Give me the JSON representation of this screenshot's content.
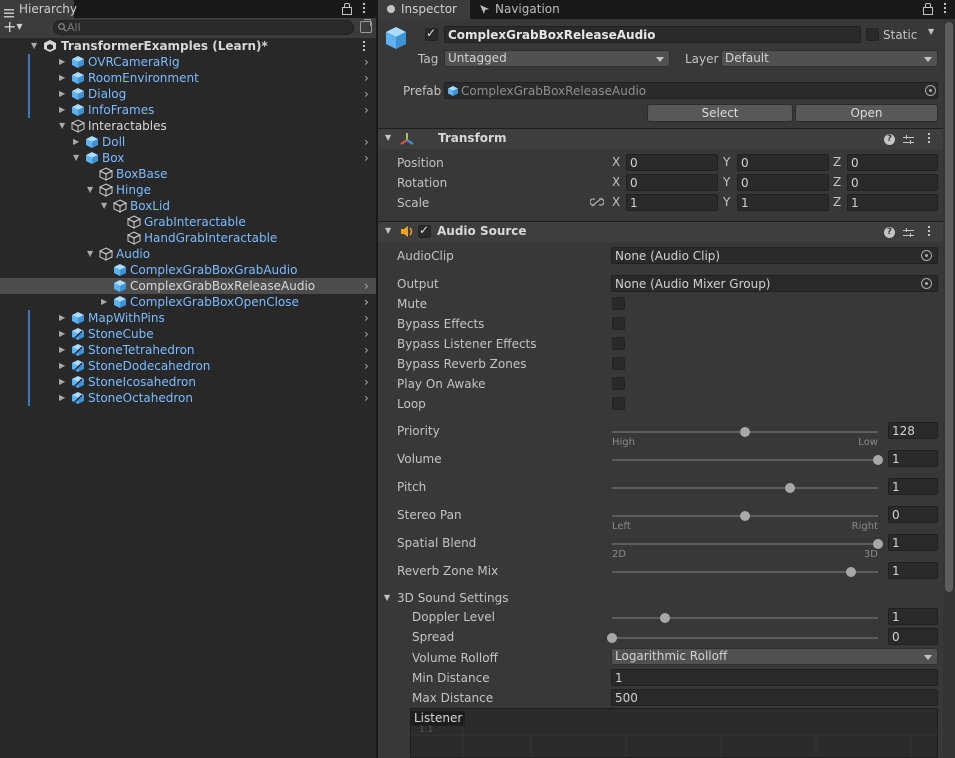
{
  "hierarchy": {
    "tab_label": "Hierarchy",
    "search_placeholder": "All",
    "scene_name": "TransformerExamples (Learn)*",
    "items": [
      {
        "label": "OVRCameraRig",
        "color": "blue",
        "arrow": "right",
        "bar": true
      },
      {
        "label": "RoomEnvironment",
        "color": "blue",
        "arrow": "right",
        "bar": true
      },
      {
        "label": "Dialog",
        "color": "blue",
        "arrow": "right",
        "bar": true
      },
      {
        "label": "InfoFrames",
        "color": "blue",
        "arrow": "right",
        "bar": true
      },
      {
        "label": "Interactables",
        "color": "white",
        "arrow": "down",
        "bar": false
      },
      {
        "label": "Doll",
        "color": "blue",
        "arrow": "right",
        "bar": false
      },
      {
        "label": "Box",
        "color": "blue",
        "arrow": "down",
        "bar": false
      },
      {
        "label": "BoxBase",
        "color": "blue",
        "arrow": "none",
        "bar": false
      },
      {
        "label": "Hinge",
        "color": "blue",
        "arrow": "down",
        "bar": false
      },
      {
        "label": "BoxLid",
        "color": "blue",
        "arrow": "down",
        "bar": false
      },
      {
        "label": "GrabInteractable",
        "color": "blue",
        "arrow": "none",
        "bar": false
      },
      {
        "label": "HandGrabInteractable",
        "color": "blue",
        "arrow": "none",
        "bar": false
      },
      {
        "label": "Audio",
        "color": "blue",
        "arrow": "down",
        "bar": false
      },
      {
        "label": "ComplexGrabBoxGrabAudio",
        "color": "blue",
        "arrow": "none",
        "bar": false
      },
      {
        "label": "ComplexGrabBoxReleaseAudio",
        "color": "white",
        "arrow": "none",
        "bar": false
      },
      {
        "label": "ComplexGrabBoxOpenClose",
        "color": "blue",
        "arrow": "right",
        "bar": false
      },
      {
        "label": "MapWithPins",
        "color": "blue",
        "arrow": "right",
        "bar": true
      },
      {
        "label": "StoneCube",
        "color": "blue",
        "arrow": "right",
        "bar": true
      },
      {
        "label": "StoneTetrahedron",
        "color": "blue",
        "arrow": "right",
        "bar": true
      },
      {
        "label": "StoneDodecahedron",
        "color": "blue",
        "arrow": "right",
        "bar": true
      },
      {
        "label": "StoneIcosahedron",
        "color": "blue",
        "arrow": "right",
        "bar": true
      },
      {
        "label": "StoneOctahedron",
        "color": "blue",
        "arrow": "right",
        "bar": true
      }
    ]
  },
  "inspector": {
    "tab_label": "Inspector",
    "nav_tab_label": "Navigation",
    "object_name": "ComplexGrabBoxReleaseAudio",
    "static_label": "Static",
    "tag_label": "Tag",
    "tag_value": "Untagged",
    "layer_label": "Layer",
    "layer_value": "Default",
    "prefab_label": "Prefab",
    "prefab_value": "ComplexGrabBoxReleaseAudio",
    "select_button": "Select",
    "open_button": "Open"
  },
  "transform": {
    "title": "Transform",
    "rows": [
      {
        "label": "Position",
        "x": "0",
        "y": "0",
        "z": "0"
      },
      {
        "label": "Rotation",
        "x": "0",
        "y": "0",
        "z": "0"
      },
      {
        "label": "Scale",
        "x": "1",
        "y": "1",
        "z": "1"
      }
    ],
    "axis_x": "X",
    "axis_y": "Y",
    "axis_z": "Z"
  },
  "audio": {
    "title": "Audio Source",
    "audioclip_label": "AudioClip",
    "audioclip_value": "None (Audio Clip)",
    "output_label": "Output",
    "output_value": "None (Audio Mixer Group)",
    "checks": [
      {
        "label": "Mute"
      },
      {
        "label": "Bypass Effects"
      },
      {
        "label": "Bypass Listener Effects"
      },
      {
        "label": "Bypass Reverb Zones"
      },
      {
        "label": "Play On Awake"
      },
      {
        "label": "Loop"
      }
    ],
    "priority": {
      "label": "Priority",
      "value": "128",
      "low_label": "High",
      "high_label": "Low",
      "level": 0.5
    },
    "volume": {
      "label": "Volume",
      "value": "1",
      "level": 1.0
    },
    "pitch": {
      "label": "Pitch",
      "value": "1",
      "level": 0.67
    },
    "stereo_pan": {
      "label": "Stereo Pan",
      "value": "0",
      "low_label": "Left",
      "high_label": "Right",
      "level": 0.5
    },
    "spatial_blend": {
      "label": "Spatial Blend",
      "value": "1",
      "low_label": "2D",
      "high_label": "3D",
      "level": 1.0
    },
    "reverb_mix": {
      "label": "Reverb Zone Mix",
      "value": "1",
      "level": 0.9
    },
    "sound3d": {
      "title": "3D Sound Settings",
      "doppler": {
        "label": "Doppler Level",
        "value": "1",
        "level": 0.2
      },
      "spread": {
        "label": "Spread",
        "value": "0",
        "level": 0.0
      },
      "rolloff_label": "Volume Rolloff",
      "rolloff_value": "Logarithmic Rolloff",
      "min_label": "Min Distance",
      "min_value": "1",
      "max_label": "Max Distance",
      "max_value": "500",
      "graph_label": "Listener",
      "graph_tick": "1.1"
    }
  },
  "colors": {
    "accent_blue": "#7cbcff",
    "selection": "#4d4d4d",
    "panel": "#383838"
  }
}
